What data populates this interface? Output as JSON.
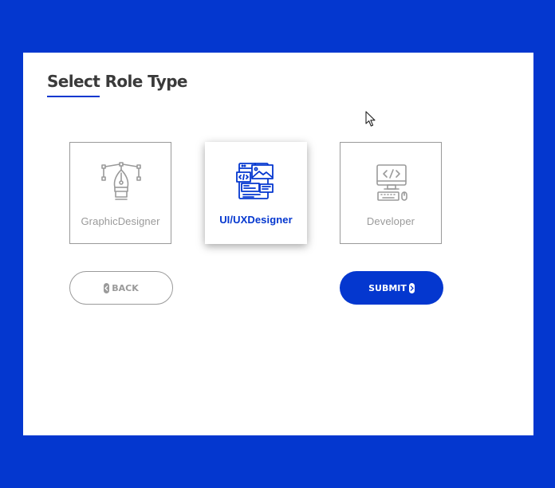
{
  "page": {
    "title": "Select Role Type"
  },
  "roles": [
    {
      "label": "GraphicDesigner",
      "icon": "pen-tool-icon",
      "selected": false
    },
    {
      "label": "UI/UXDesigner",
      "icon": "ui-ux-design-icon",
      "selected": true
    },
    {
      "label": "Developer",
      "icon": "developer-computer-icon",
      "selected": false
    }
  ],
  "actions": {
    "back_label": "BACK",
    "submit_label": "SUBMIT"
  },
  "colors": {
    "accent": "#0437cf",
    "muted": "#9a9a9a",
    "title": "#3a3a3a",
    "background": "#ffffff"
  }
}
